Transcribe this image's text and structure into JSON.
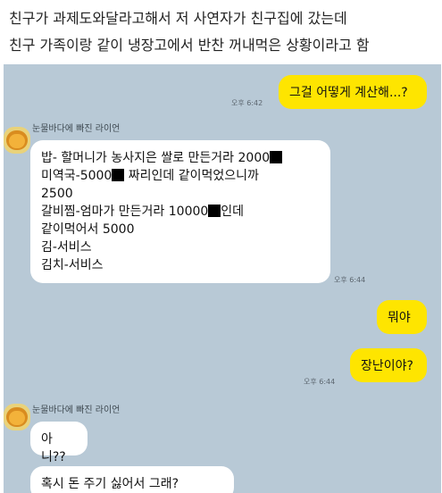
{
  "caption": {
    "line1": "친구가 과제도와달라고해서 저 사연자가 친구집에 갔는데",
    "line2": "친구 가족이랑 같이 냉장고에서 반찬 꺼내먹은 상황이라고 함"
  },
  "chat": {
    "messages": [
      {
        "sender": "me",
        "text": "그걸 어떻게 계산해...?",
        "time": "오후 6:42"
      },
      {
        "sender": "other",
        "name": "눈물바다에 빠진 라이언",
        "lines": [
          "밥- 할머니가 농사지은 쌀로 만든거라 2000",
          "미역국-5000",
          " 짜리인데 같이먹었으니까",
          "2500",
          "갈비찜-엄마가 만든거라 10000",
          "인데",
          "같이먹어서 5000",
          "김-서비스",
          "김치-서비스"
        ],
        "time": "오후 6:44"
      },
      {
        "sender": "me",
        "text": "뭐야"
      },
      {
        "sender": "me",
        "text": "장난이야?",
        "time": "오후 6:44"
      },
      {
        "sender": "other",
        "name": "눈물바다에 빠진 라이언",
        "text": "아니??"
      },
      {
        "sender": "other",
        "text": "혹시 돈 주기 싫어서 그래?"
      }
    ]
  },
  "colors": {
    "chat_bg": "#b8c9d6",
    "my_bubble": "#fee500",
    "their_bubble": "#ffffff"
  },
  "icons": {
    "avatar": "ryan-avatar-icon",
    "redaction": "redaction-block"
  }
}
